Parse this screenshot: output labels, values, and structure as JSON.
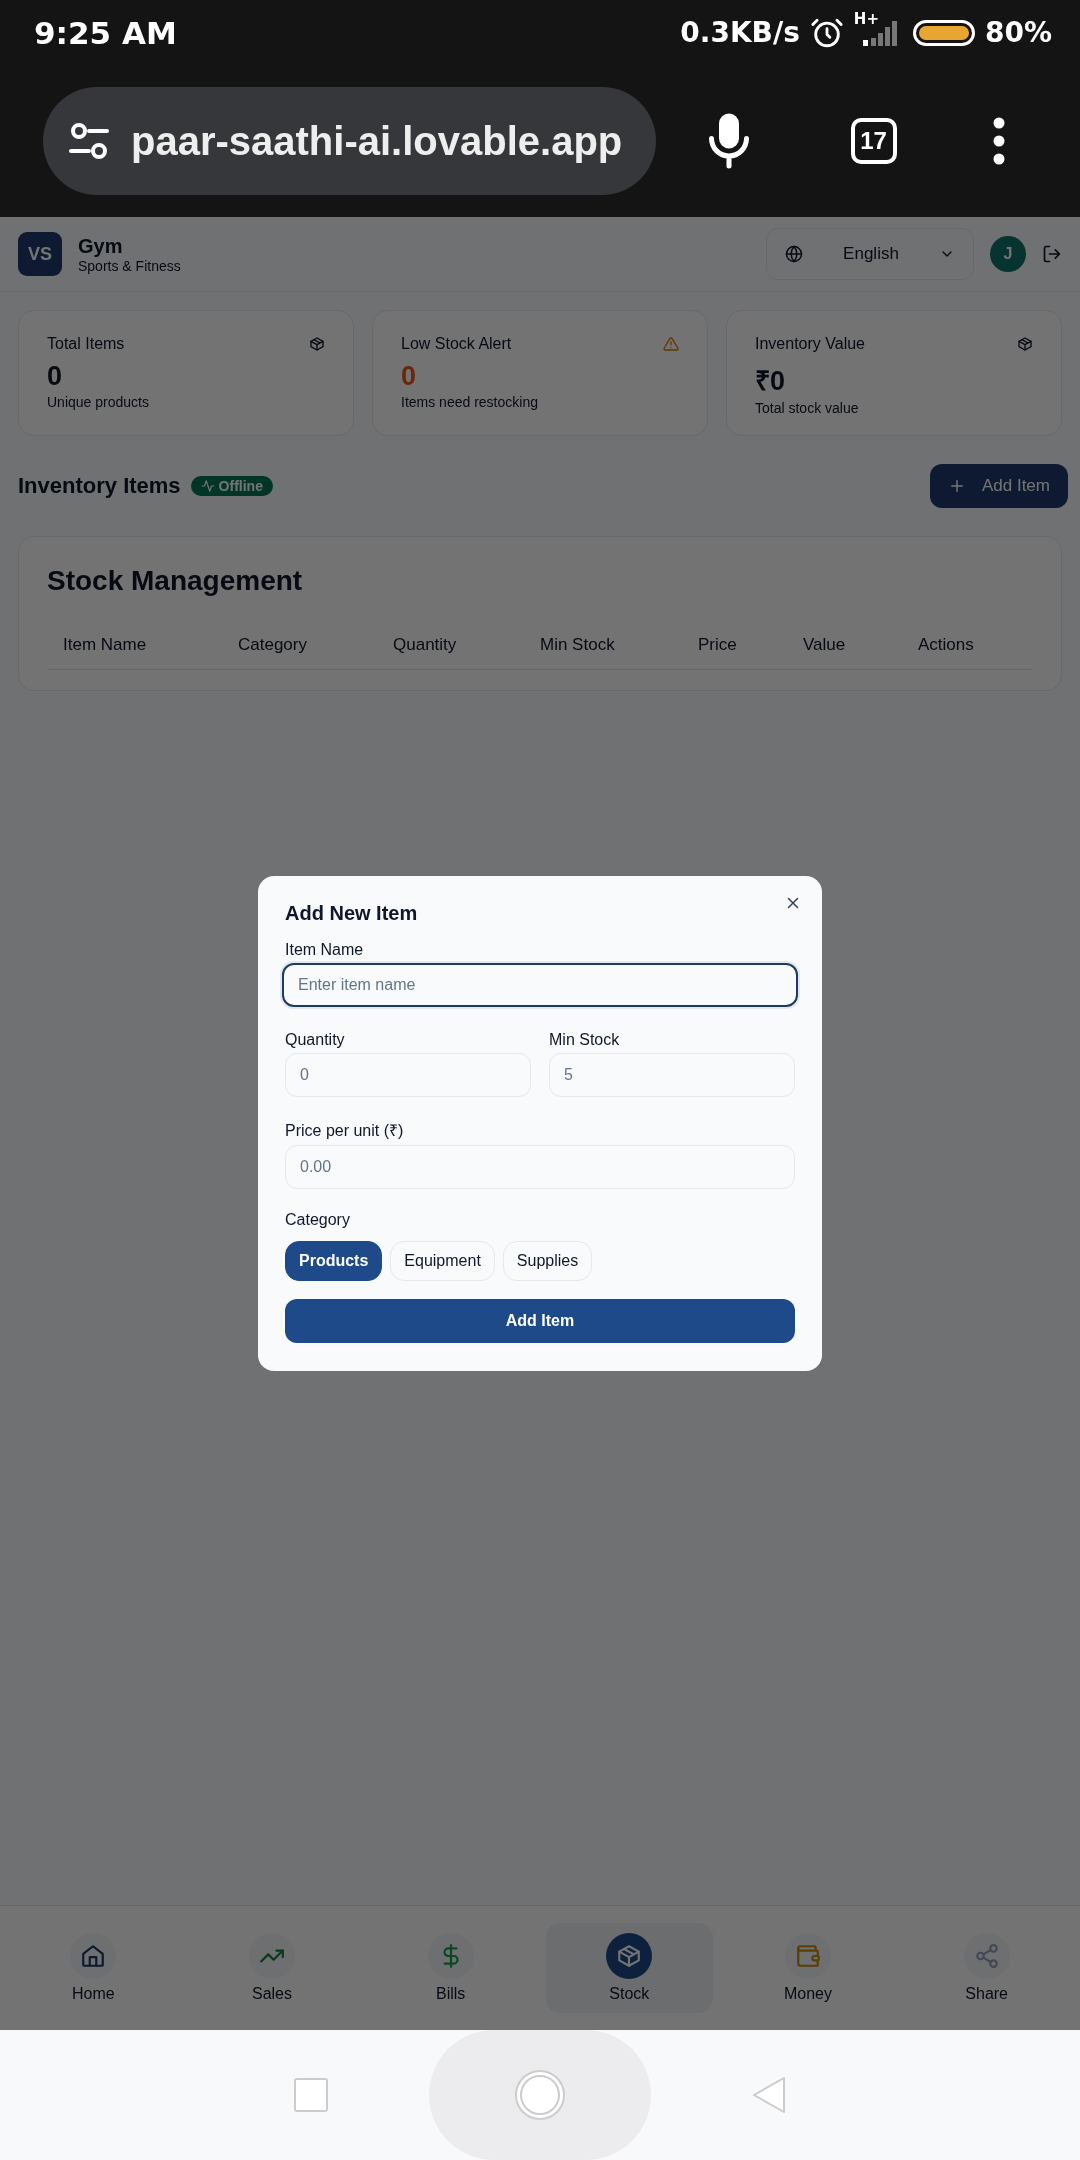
{
  "status_bar": {
    "time": "9:25 AM",
    "speed": "0.3KB/s",
    "network": "H+",
    "battery": "80%"
  },
  "browser": {
    "url": "paar-saathi-ai.lovable.app",
    "tab_count": "17"
  },
  "header": {
    "logo": "VS",
    "business": "Gym",
    "category": "Sports & Fitness",
    "language": "English",
    "avatar": "J"
  },
  "stats": [
    {
      "kind": "box",
      "label": "Total Items",
      "value": "0",
      "caption": "Unique products"
    },
    {
      "kind": "warning",
      "label": "Low Stock Alert",
      "value": "0",
      "caption": "Items need restocking"
    },
    {
      "kind": "box",
      "label": "Inventory Value",
      "value": "₹0",
      "caption": "Total stock value"
    }
  ],
  "inventory": {
    "title": "Inventory Items",
    "status": "Offline",
    "add_button": "Add Item"
  },
  "stock_table": {
    "title": "Stock Management",
    "columns": [
      "Item Name",
      "Category",
      "Quantity",
      "Min Stock",
      "Price",
      "Value",
      "Actions"
    ]
  },
  "dialog": {
    "title": "Add New Item",
    "rows": [
      [
        {
          "label": "Item Name",
          "placeholder": "Enter item name",
          "focused": true
        }
      ],
      [
        {
          "label": "Quantity",
          "placeholder": "0",
          "focused": false
        },
        {
          "label": "Min Stock",
          "placeholder": "5",
          "focused": false
        }
      ],
      [
        {
          "label": "Price per unit (₹)",
          "placeholder": "0.00",
          "focused": false
        }
      ]
    ],
    "category_label": "Category",
    "categories": [
      {
        "label": "Products",
        "selected": true
      },
      {
        "label": "Equipment",
        "selected": false
      },
      {
        "label": "Supplies",
        "selected": false
      }
    ],
    "submit": "Add Item"
  },
  "bottom_nav": [
    {
      "kind": "home",
      "label": "Home",
      "selected": false
    },
    {
      "kind": "sales",
      "label": "Sales",
      "selected": false
    },
    {
      "kind": "bills",
      "label": "Bills",
      "selected": false
    },
    {
      "kind": "stock",
      "label": "Stock",
      "selected": true
    },
    {
      "kind": "money",
      "label": "Money",
      "selected": false
    },
    {
      "kind": "share",
      "label": "Share",
      "selected": false
    }
  ]
}
